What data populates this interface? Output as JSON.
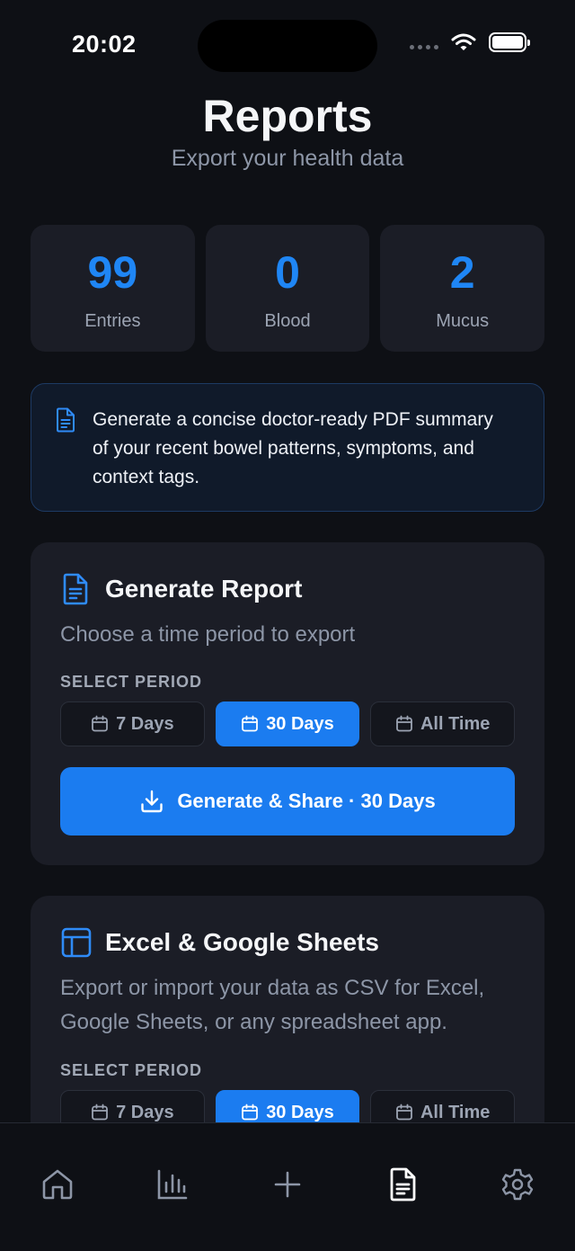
{
  "status_bar": {
    "time": "20:02"
  },
  "header": {
    "title": "Reports",
    "subtitle": "Export your health data"
  },
  "stats": [
    {
      "value": "99",
      "label": "Entries"
    },
    {
      "value": "0",
      "label": "Blood"
    },
    {
      "value": "2",
      "label": "Mucus"
    }
  ],
  "info_banner": {
    "text": "Generate a concise doctor-ready PDF summary of your recent bowel patterns, symptoms, and context tags."
  },
  "generate_report": {
    "title": "Generate Report",
    "description": "Choose a time period to export",
    "section_label": "SELECT PERIOD",
    "periods": [
      "7 Days",
      "30 Days",
      "All Time"
    ],
    "selected_period": "30 Days",
    "button_label": "Generate & Share · 30 Days"
  },
  "sheets_export": {
    "title": "Excel & Google Sheets",
    "description": "Export or import your data as CSV for Excel, Google Sheets, or any spreadsheet app.",
    "section_label": "SELECT PERIOD",
    "periods": [
      "7 Days",
      "30 Days",
      "All Time"
    ],
    "selected_period": "30 Days"
  },
  "tab_bar": {
    "tabs": [
      "home-icon",
      "chart-icon",
      "plus-icon",
      "report-icon",
      "gear-icon"
    ],
    "active_tab": "report-icon"
  },
  "colors": {
    "accent": "#1b7cf0",
    "stat_value": "#1f86f5",
    "background": "#0e1015",
    "card": "#1b1d26"
  }
}
